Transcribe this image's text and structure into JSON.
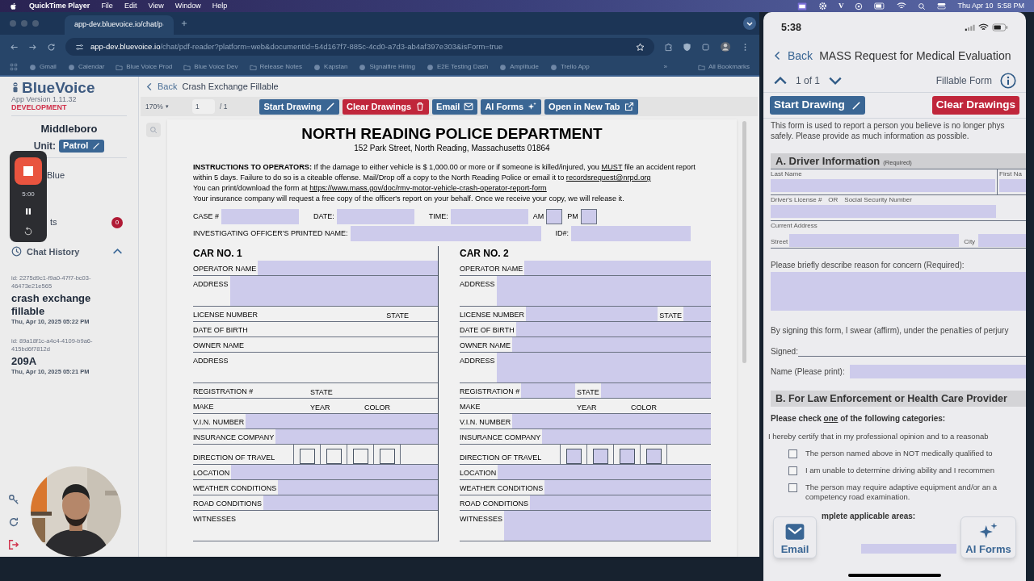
{
  "menubar": {
    "app": "QuickTime Player",
    "menus": [
      "File",
      "Edit",
      "View",
      "Window",
      "Help"
    ],
    "status_letter": "V",
    "clock": "Thu Apr 10  5:58 PM"
  },
  "browser": {
    "tab": {
      "title": "app-dev.bluevoice.io/chat/p",
      "selected": true
    },
    "url_host": "app-dev.bluevoice.io",
    "url_path": "/chat/pdf-reader?platform=web&documentId=54d167f7-885c-4cd0-a7d3-ab4af397e303&isForm=true",
    "bookmarks": [
      {
        "label": "Gmail",
        "kind": "site"
      },
      {
        "label": "Calendar",
        "kind": "site"
      },
      {
        "label": "Blue Voice Prod",
        "kind": "folder"
      },
      {
        "label": "Blue Voice Dev",
        "kind": "folder"
      },
      {
        "label": "Release Notes",
        "kind": "folder"
      },
      {
        "label": "Kapstan",
        "kind": "site"
      },
      {
        "label": "Signalfire Hiring",
        "kind": "site"
      },
      {
        "label": "E2E Testing Dash",
        "kind": "site"
      },
      {
        "label": "Amplitude",
        "kind": "site"
      },
      {
        "label": "Trello App",
        "kind": "site"
      }
    ],
    "bookmarks_more": "»",
    "all_bookmarks": "All Bookmarks"
  },
  "sidebar": {
    "brand": "BlueVoice",
    "version": "App Version 1.11.32",
    "environment": "DEVELOPMENT",
    "department": "Middleboro",
    "unit_label": "Unit:",
    "unit": "Patrol",
    "items": [
      {
        "label": "Blue"
      },
      {
        "label": "ts",
        "badge": "0"
      }
    ],
    "chat_history": {
      "title": "Chat History",
      "expanded": true,
      "chats": [
        {
          "id": "id: 2275d9c1-f9a0-47f7-bc03-46473e21e565",
          "title": "crash exchange fillable",
          "date": "Thu, Apr 10, 2025 05:22 PM"
        },
        {
          "id": "id: 89a18f1c-a4c4-4109-b9a6-415bd6f7812d",
          "title": "209A",
          "date": "Thu, Apr 10, 2025 05:21 PM"
        }
      ]
    }
  },
  "recorder": {
    "time": "5:00"
  },
  "viewer": {
    "back": "Back",
    "title": "Crash Exchange Fillable",
    "zoom": "170%",
    "zoom_caret": "▾",
    "page": "1",
    "page_total": "/ 1",
    "actions": [
      {
        "label": "Start Drawing",
        "kind": "draw"
      },
      {
        "label": "Clear Drawings",
        "kind": "clear"
      },
      {
        "label": "Email",
        "kind": "email"
      },
      {
        "label": "AI Forms",
        "kind": "ai"
      },
      {
        "label": "Open in New Tab",
        "kind": "open"
      }
    ]
  },
  "form": {
    "heading": "NORTH READING POLICE DEPARTMENT",
    "address": "152 Park Street, North Reading, Massachusetts 01864",
    "instructions": [
      [
        {
          "text": "INSTRUCTIONS TO OPERATORS:",
          "kind": "bold"
        },
        {
          "text": " If the damage to either vehicle is $ 1,000.00 or more or if someone is killed/injured, you ",
          "kind": "plain"
        },
        {
          "text": "MUST",
          "kind": "underline"
        },
        {
          "text": " file an accident report within 5 days. Failure to do so is a citeable offense. Mail/Drop off a copy to the North Reading Police or email it to ",
          "kind": "plain"
        },
        {
          "text": "recordsrequest@nrpd.org",
          "kind": "link"
        }
      ],
      [
        {
          "text": "You can print/download the form at ",
          "kind": "plain"
        },
        {
          "text": "https://www.mass.gov/doc/rmv-motor-vehicle-crash-operator-report-form",
          "kind": "link"
        }
      ],
      [
        {
          "text": "Your insurance company will request a free copy of the officer's report on your behalf. Once we receive your copy, we will release it.",
          "kind": "plain"
        }
      ]
    ],
    "header_fields": [
      [
        {
          "label": "CASE #",
          "kind": "short"
        },
        {
          "label": "DATE:",
          "kind": "short"
        },
        {
          "label": "TIME:",
          "kind": "short"
        },
        {
          "label": "AM",
          "kind": "box"
        },
        {
          "label": "PM",
          "kind": "box"
        }
      ],
      [
        {
          "label": "INVESTIGATING OFFICER'S PRINTED NAME:",
          "kind": "long"
        },
        {
          "label": "ID#:",
          "kind": "medium"
        }
      ]
    ],
    "cars": [
      {
        "title": "CAR NO. 1",
        "rows": [
          {
            "kind": "single",
            "label": "OPERATOR NAME",
            "highlighted": true
          },
          {
            "kind": "tall",
            "label": "ADDRESS",
            "highlighted": true
          },
          {
            "kind": "state",
            "label": "LICENSE NUMBER",
            "extras": [
              "STATE"
            ],
            "highlighted": false
          },
          {
            "kind": "single",
            "label": "DATE OF BIRTH",
            "highlighted": false
          },
          {
            "kind": "single",
            "label": "OWNER NAME",
            "highlighted": false
          },
          {
            "kind": "tall",
            "label": "ADDRESS",
            "highlighted": false
          },
          {
            "kind": "reg",
            "label": "REGISTRATION #",
            "extras": [
              "STATE"
            ],
            "highlighted": false
          },
          {
            "kind": "make",
            "label": "MAKE",
            "extras": [
              "YEAR",
              "COLOR"
            ],
            "highlighted": false
          },
          {
            "kind": "single",
            "label": "V.I.N. NUMBER",
            "highlighted": true
          },
          {
            "kind": "single",
            "label": "INSURANCE COMPANY",
            "highlighted": true
          },
          {
            "kind": "direction",
            "label": "DIRECTION OF TRAVEL",
            "highlighted": false,
            "boxes": [
              {
                "checked": false
              },
              {
                "checked": false
              },
              {
                "checked": false
              },
              {
                "checked": false
              }
            ]
          },
          {
            "kind": "single",
            "label": "LOCATION",
            "highlighted": true
          },
          {
            "kind": "single",
            "label": "WEATHER CONDITIONS",
            "highlighted": true
          },
          {
            "kind": "single",
            "label": "ROAD CONDITIONS",
            "highlighted": true
          },
          {
            "kind": "tall",
            "label": "WITNESSES",
            "highlighted": false
          }
        ]
      },
      {
        "title": "CAR NO. 2",
        "rows": [
          {
            "kind": "single",
            "label": "OPERATOR NAME",
            "highlighted": true
          },
          {
            "kind": "tall",
            "label": "ADDRESS",
            "highlighted": true
          },
          {
            "kind": "state",
            "label": "LICENSE NUMBER",
            "extras": [
              "STATE"
            ],
            "highlighted": true
          },
          {
            "kind": "single",
            "label": "DATE OF BIRTH",
            "highlighted": true
          },
          {
            "kind": "single",
            "label": "OWNER NAME",
            "highlighted": true
          },
          {
            "kind": "tall",
            "label": "ADDRESS",
            "highlighted": true
          },
          {
            "kind": "reg",
            "label": "REGISTRATION #",
            "extras": [
              "STATE"
            ],
            "highlighted": true
          },
          {
            "kind": "make",
            "label": "MAKE",
            "extras": [
              "YEAR",
              "COLOR"
            ],
            "highlighted": false
          },
          {
            "kind": "single",
            "label": "V.I.N. NUMBER",
            "highlighted": true
          },
          {
            "kind": "single",
            "label": "INSURANCE COMPANY",
            "highlighted": true
          },
          {
            "kind": "direction",
            "label": "DIRECTION OF TRAVEL",
            "highlighted": true,
            "boxes": [
              {
                "checked": false
              },
              {
                "checked": false
              },
              {
                "checked": false
              },
              {
                "checked": false
              }
            ]
          },
          {
            "kind": "single",
            "label": "LOCATION",
            "highlighted": true
          },
          {
            "kind": "single",
            "label": "WEATHER CONDITIONS",
            "highlighted": true
          },
          {
            "kind": "single",
            "label": "ROAD CONDITIONS",
            "highlighted": true
          },
          {
            "kind": "tall",
            "label": "WITNESSES",
            "highlighted": true
          }
        ]
      }
    ]
  },
  "phone": {
    "time": "5:38",
    "back": "Back",
    "title": "MASS Request for Medical Evaluation",
    "pager": "1 of 1",
    "mode": "Fillable Form",
    "buttons": [
      {
        "label": "Start Drawing",
        "kind": "draw"
      },
      {
        "label": "Clear Drawings",
        "kind": "clear"
      }
    ],
    "intro_lines": [
      "This form is used to report a person you believe is no longer phys",
      "safely. Please provide as much information as possible."
    ],
    "section_a": {
      "title": "A. Driver Information",
      "note": "(Required)",
      "last_name": "Last Name",
      "first_name": "First Na",
      "license": "Driver's License #",
      "or": "OR",
      "ssn": "Social Security Number",
      "address": "Current Address",
      "street": "Street",
      "city": "City"
    },
    "concern": "Please briefly describe reason for concern (Required):",
    "oath": "By signing this form, I swear (affirm), under the penalties of perjury",
    "signed": "Signed:",
    "print_name": "Name (Please print):",
    "section_b": {
      "title": "B. For Law Enforcement or Health Care Provider"
    },
    "check_prompt": [
      "Please check ",
      "one",
      " of the following categories:"
    ],
    "certify": "I hereby certify that in my professional opinion and to a reasonab",
    "options": [
      {
        "lines": [
          "The person named above in NOT medically qualified to"
        ],
        "checked": false
      },
      {
        "lines": [
          "I am unable to determine driving ability and I recommen"
        ],
        "checked": false
      },
      {
        "lines": [
          "The person may require adaptive equipment and/or an a",
          "competency road examination."
        ],
        "checked": false
      }
    ],
    "partial": "mplete applicable areas:",
    "fabs": [
      {
        "label": "Email",
        "kind": "email"
      },
      {
        "label": "AI Forms",
        "kind": "ai"
      }
    ]
  }
}
